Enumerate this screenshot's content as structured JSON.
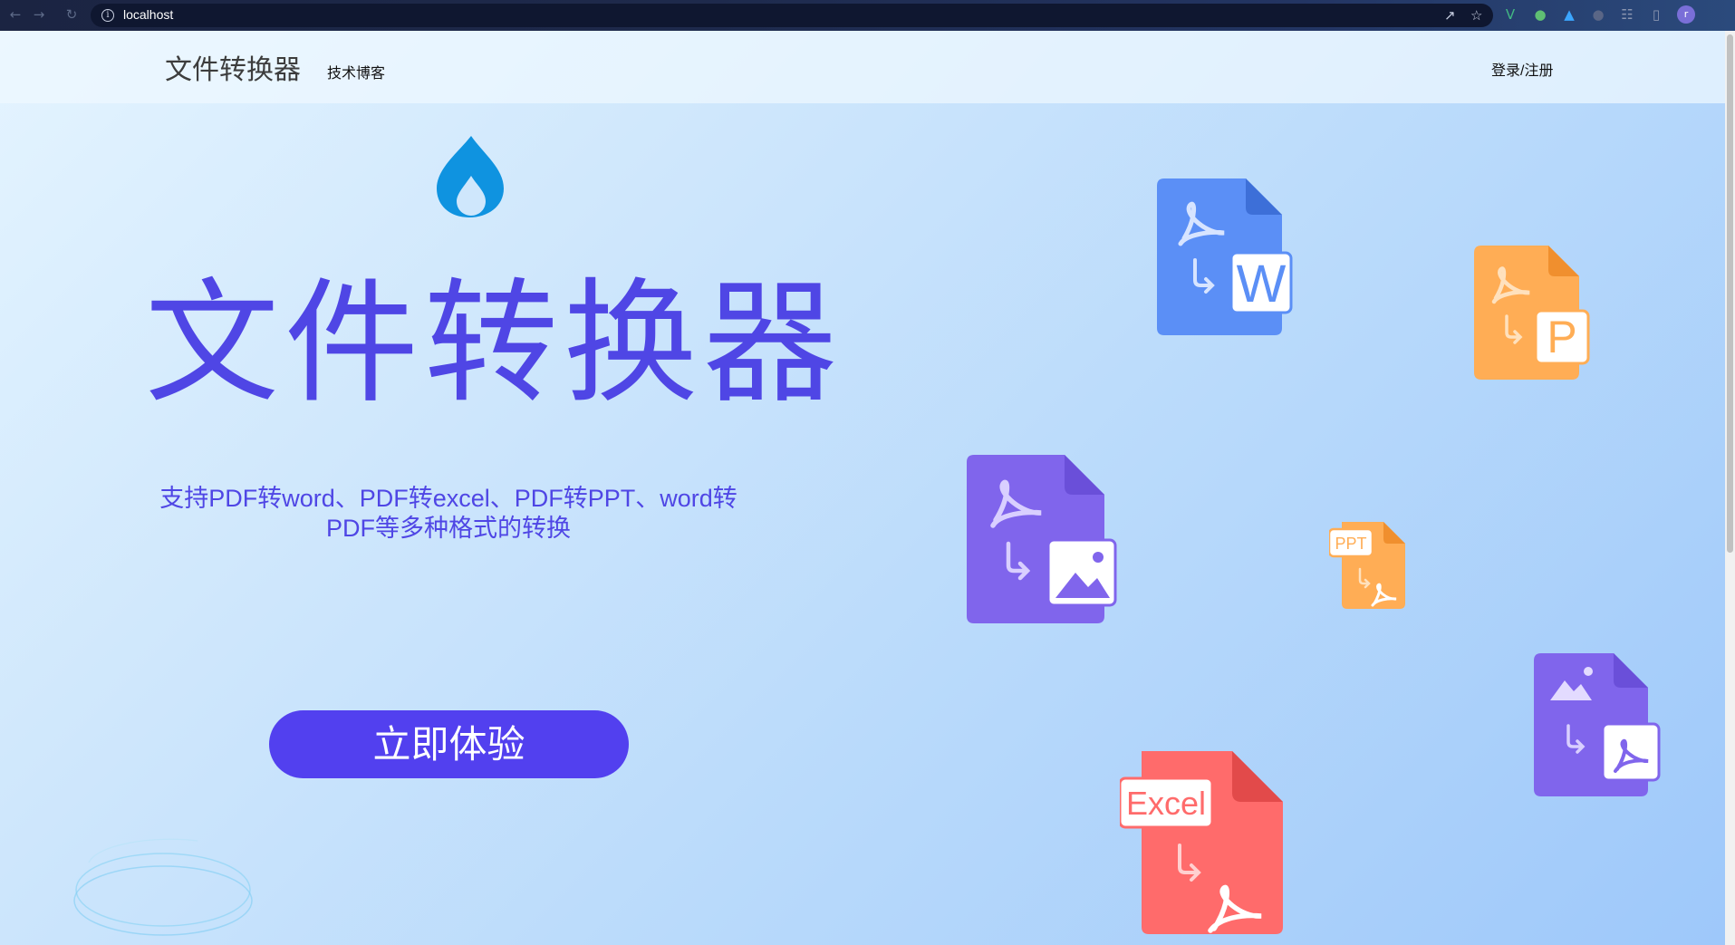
{
  "browser": {
    "url": "localhost",
    "avatar_letter": "r"
  },
  "header": {
    "brand": "文件转换器",
    "nav_blog": "技术博客",
    "login": "登录/注册"
  },
  "hero": {
    "title": "文件转换器",
    "description": "支持PDF转word、PDF转excel、PDF转PPT、word转PDF等多种格式的转换",
    "cta_label": "立即体验"
  },
  "illustrations": {
    "word_badge": "W",
    "ppt_badge": "P",
    "ppt_small_tag": "PPT",
    "excel_tag": "Excel"
  },
  "colors": {
    "accent": "#4f46e5",
    "button": "#5240ef",
    "word_blue": "#5b8ff6",
    "ppt_orange": "#ffad55",
    "image_purple": "#8065ec",
    "excel_red": "#ff6b6b"
  }
}
